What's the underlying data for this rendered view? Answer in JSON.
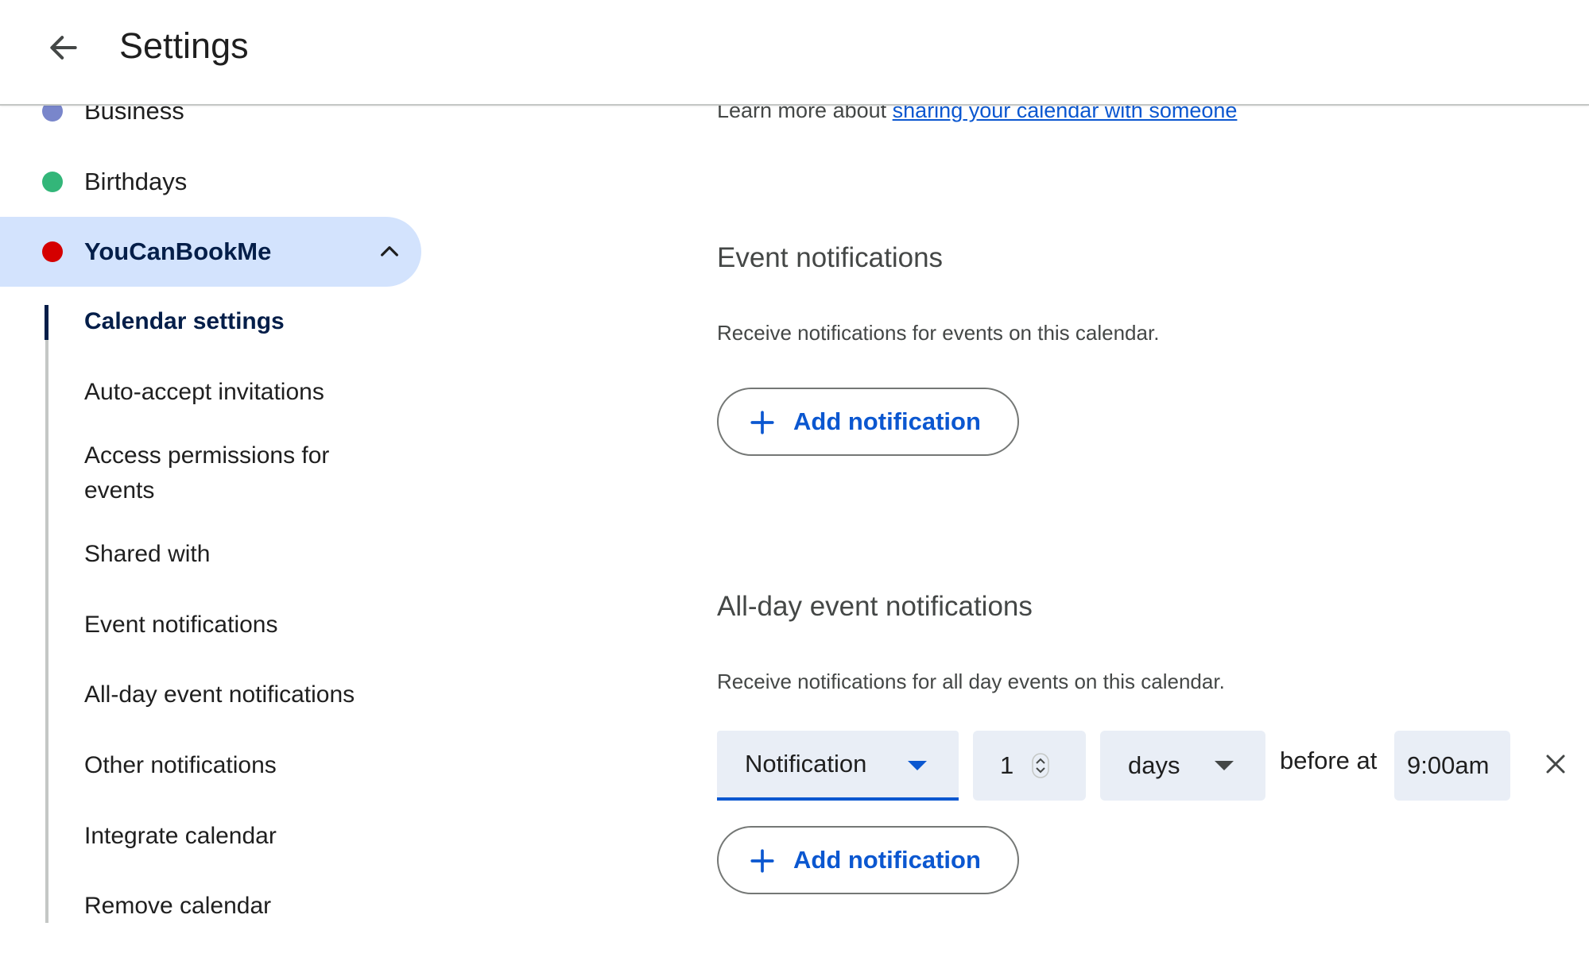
{
  "header": {
    "back_icon": "arrow-back-icon",
    "title": "Settings"
  },
  "sidebar": {
    "calendars": [
      {
        "label": "Business",
        "color": "#7986cb"
      },
      {
        "label": "Birthdays",
        "color": "#33b679"
      },
      {
        "label": "YouCanBookMe",
        "color": "#d50000",
        "expanded": true,
        "chevron_icon": "chevron-up-icon"
      }
    ],
    "sub_items": [
      {
        "label": "Calendar settings",
        "active": true
      },
      {
        "label": "Auto-accept invitations"
      },
      {
        "label": "Access permissions for events"
      },
      {
        "label": "Shared with"
      },
      {
        "label": "Event notifications"
      },
      {
        "label": "All-day event notifications"
      },
      {
        "label": "Other notifications"
      },
      {
        "label": "Integrate calendar"
      },
      {
        "label": "Remove calendar"
      }
    ]
  },
  "main": {
    "learn_more_prefix": "Learn more about",
    "learn_more_link": "sharing your calendar with someone",
    "event_notifications": {
      "title": "Event notifications",
      "description": "Receive notifications for events on this calendar.",
      "add_button": "Add notification"
    },
    "allday_notifications": {
      "title": "All-day event notifications",
      "description": "Receive notifications for all day events on this calendar.",
      "row": {
        "type": "Notification",
        "amount": "1",
        "unit": "days",
        "before_at": "before at",
        "time": "9:00am"
      },
      "add_button": "Add notification"
    }
  },
  "colors": {
    "accent": "#0b57d0",
    "active_bg": "#d3e3fd",
    "field_bg": "#e9eef6"
  }
}
